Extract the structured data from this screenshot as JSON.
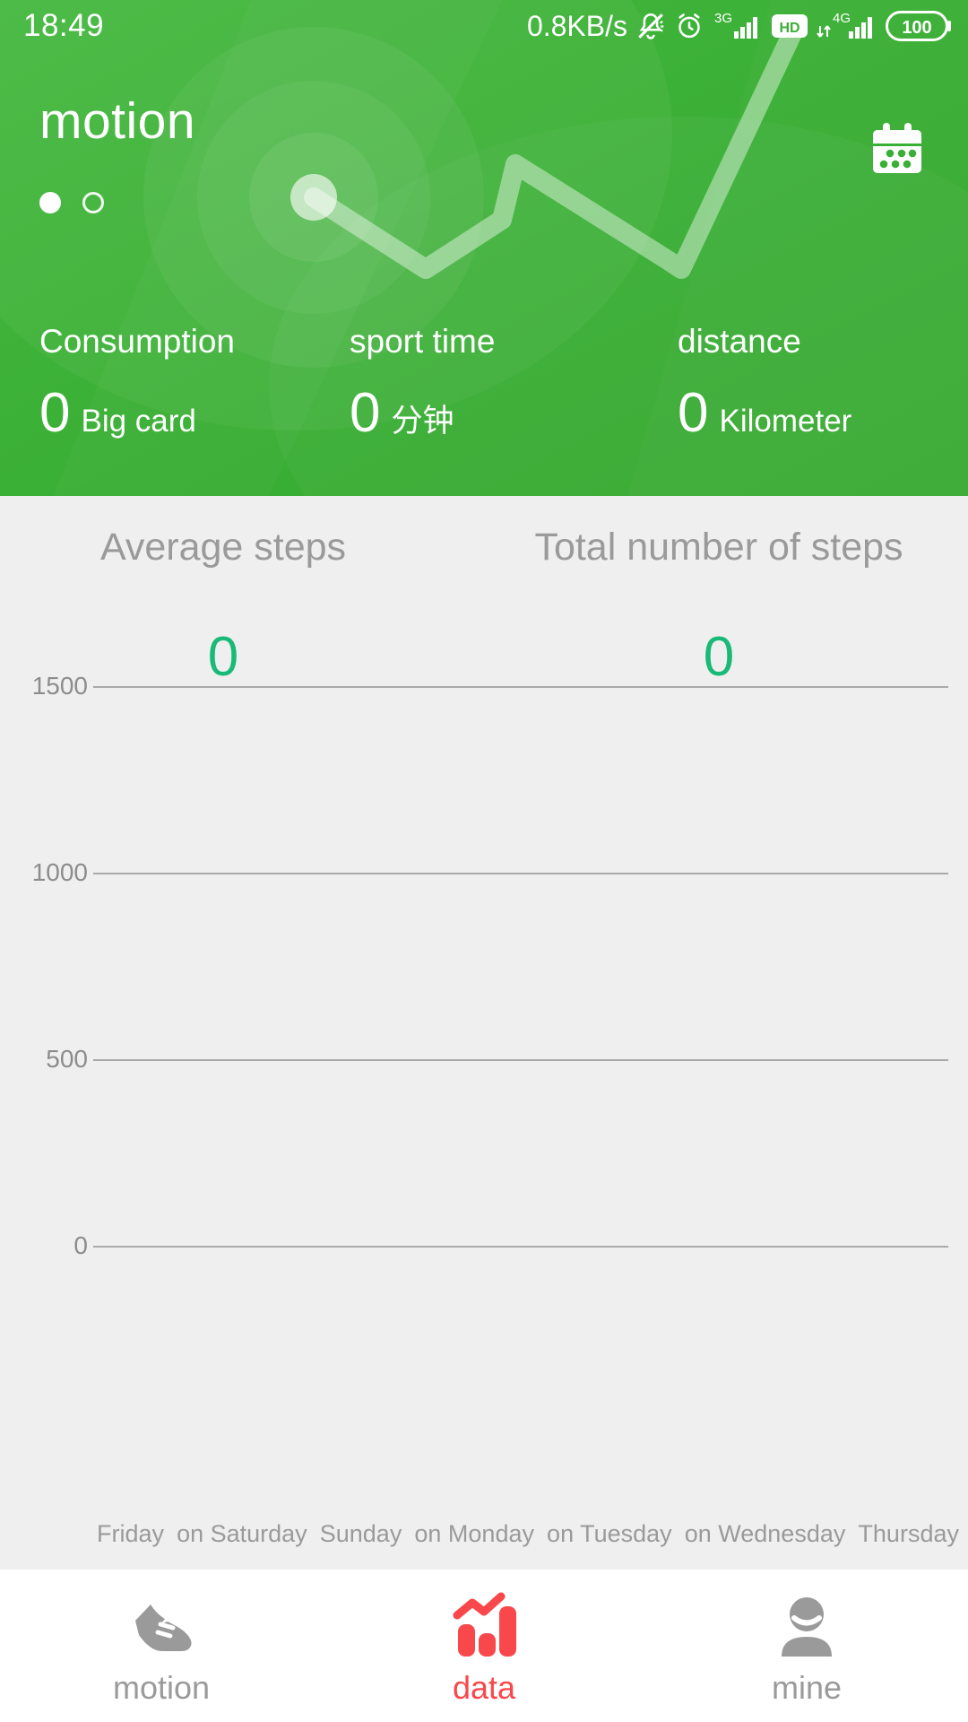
{
  "status_bar": {
    "time": "18:49",
    "net_speed": "0.8KB/s",
    "icons": [
      "mute-bell-icon",
      "alarm-clock-icon",
      "signal-3g-icon",
      "hd-icon",
      "signal-4g-icon",
      "battery-icon"
    ],
    "battery_level": "100",
    "net_3g_label": "3G",
    "net_4g_label": "4G",
    "hd_label": "HD"
  },
  "header": {
    "title": "motion",
    "calendar_icon": "calendar-icon",
    "page_indicator": {
      "total": 2,
      "active_index": 0
    },
    "accent_color": "#3aaf35",
    "stats": [
      {
        "label": "Consumption",
        "value": "0",
        "unit": "Big card"
      },
      {
        "label": "sport time",
        "value": "0",
        "unit": "分钟"
      },
      {
        "label": "distance",
        "value": "0",
        "unit": "Kilometer"
      }
    ]
  },
  "summary": [
    {
      "label": "Average steps",
      "value": "0"
    },
    {
      "label": "Total number of steps",
      "value": "0"
    }
  ],
  "summary_value_color": "#1bb978",
  "chart_data": {
    "type": "bar",
    "title": "",
    "xlabel": "",
    "ylabel": "",
    "categories": [
      "Friday",
      "on Saturday",
      "Sunday",
      "on Monday",
      "on Tuesday",
      "on Wednesday",
      "Thursday"
    ],
    "values": [
      0,
      0,
      0,
      0,
      0,
      0,
      0
    ],
    "yticks": [
      "1500",
      "1000",
      "500",
      "0"
    ],
    "ytick_values": [
      1500,
      1000,
      500,
      0
    ],
    "ylim": [
      0,
      1750
    ],
    "grid": true,
    "legend": "none",
    "gridline_color": "#a9a9a9",
    "label_color": "#9a9a9a"
  },
  "bottom_nav": {
    "active_color": "#f8484b",
    "inactive_color": "#9a9a9a",
    "items": [
      {
        "label": "motion",
        "icon": "shoe-icon",
        "active": false
      },
      {
        "label": "data",
        "icon": "bar-chart-icon",
        "active": true
      },
      {
        "label": "mine",
        "icon": "person-icon",
        "active": false
      }
    ]
  }
}
